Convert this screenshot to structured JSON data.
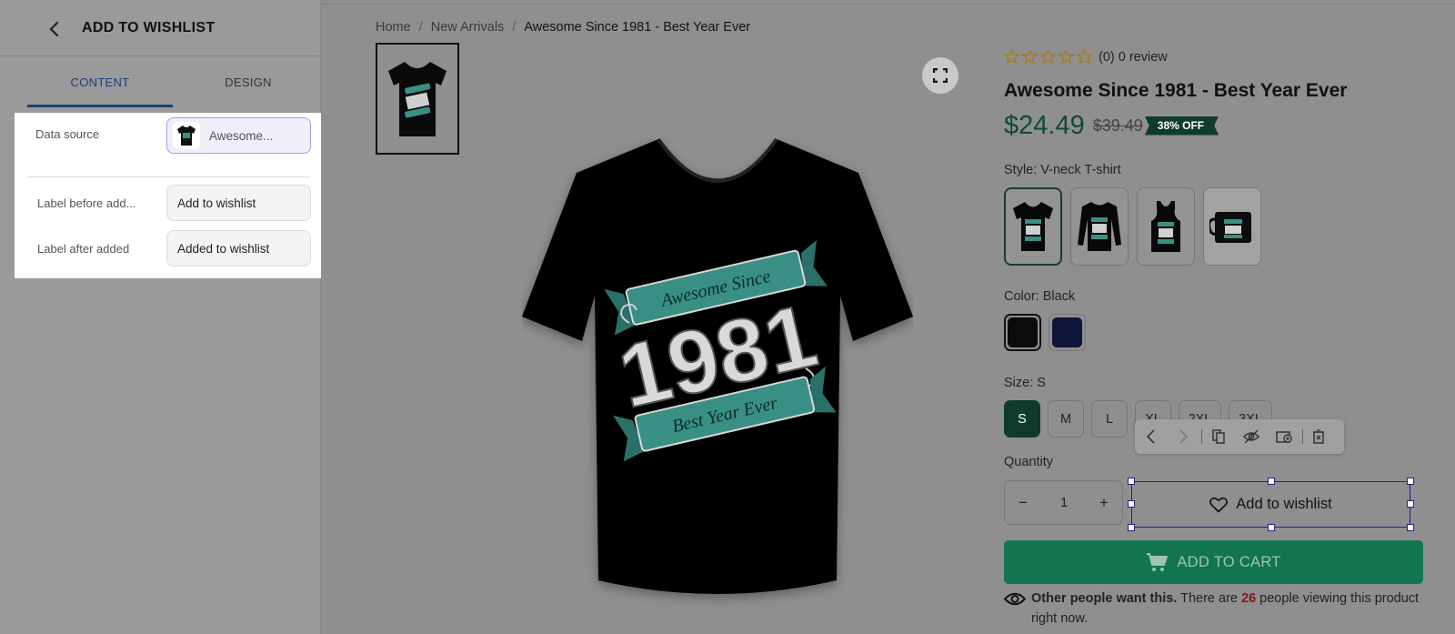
{
  "panel": {
    "title": "ADD TO WISHLIST",
    "tabs": [
      {
        "label": "CONTENT",
        "active": true
      },
      {
        "label": "DESIGN",
        "active": false
      }
    ],
    "fields": {
      "data_source": {
        "label": "Data source",
        "value": "Awesome..."
      },
      "label_before": {
        "label": "Label before add...",
        "value": "Add to wishlist"
      },
      "label_after": {
        "label": "Label after added",
        "value": "Added to wishlist"
      }
    }
  },
  "breadcrumb": [
    "Home",
    "New Arrivals",
    "Awesome Since 1981 - Best Year Ever"
  ],
  "product": {
    "review_text": "(0) 0 review",
    "rating": 0,
    "title": "Awesome Since 1981 - Best Year Ever",
    "price": "$24.49",
    "old_price": "$39.49",
    "discount_badge": "38% OFF",
    "style_label": "Style: V-neck T-shirt",
    "styles": [
      "V-neck T-shirt",
      "Long sleeve",
      "Tank top",
      "Mug"
    ],
    "color_label": "Color: Black",
    "colors": [
      {
        "name": "Black",
        "hex": "#0b0b0b"
      },
      {
        "name": "Navy",
        "hex": "#0f1538"
      }
    ],
    "size_label": "Size: S",
    "sizes": [
      "S",
      "M",
      "L",
      "XL",
      "2XL",
      "3XL"
    ],
    "quantity_label": "Quantity",
    "quantity": "1",
    "wishlist_label": "Add to wishlist",
    "cart_label": "ADD TO CART",
    "viewers": {
      "lead": "Other people want this.",
      "pre": " There are ",
      "count": "26",
      "post": " people viewing this product right now."
    },
    "artwork": {
      "line1": "Awesome Since",
      "year": "1981",
      "line2": "Best Year Ever"
    }
  },
  "colors": {
    "accent_green": "#137550",
    "dark_green": "#0f3b2c",
    "selection": "#2b1e86",
    "tab_active": "#1f3f7a"
  }
}
